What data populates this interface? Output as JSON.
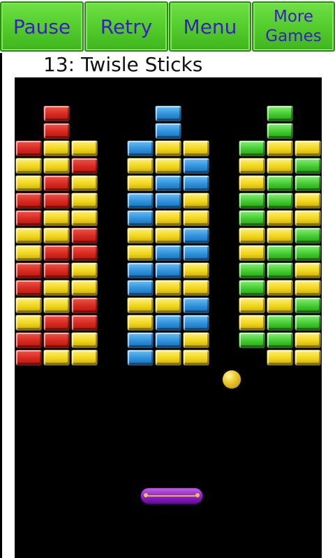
{
  "toolbar": {
    "pause_label": "Pause",
    "retry_label": "Retry",
    "menu_label": "Menu",
    "more_games_label": "More\nGames"
  },
  "level": {
    "title": "13: Twisle Sticks"
  },
  "colors": {
    "button_green": "#56cf2e",
    "button_text": "#3a1fc0",
    "brick_red": "#d62a20",
    "brick_yellow": "#f1d61b",
    "brick_blue": "#2f92dc",
    "brick_green": "#43cc2f",
    "ball": "#f2cf34",
    "paddle": "#8e22c9"
  },
  "bricks": {
    "legend": {
      "R": "red",
      "Y": "yellow",
      "B": "blue",
      "G": "green"
    },
    "groups": [
      {
        "name": "red-stick",
        "rows": [
          "-R-",
          "-R-",
          "RYY",
          "YYR",
          "YRY",
          "RRY",
          "RYY",
          "YYR",
          "YRR",
          "RRY",
          "RYY",
          "YYR",
          "YRR",
          "RRY",
          "RYY"
        ]
      },
      {
        "name": "blue-stick",
        "rows": [
          "-B-",
          "-B-",
          "BYY",
          "YYB",
          "YBB",
          "BBY",
          "BYY",
          "YYB",
          "YBB",
          "BBY",
          "BYY",
          "YYB",
          "YBB",
          "BBY",
          "BYY"
        ]
      },
      {
        "name": "green-stick",
        "rows": [
          "-G-",
          "-G-",
          "GYY",
          "YYG",
          "YGG",
          "GGY",
          "GYY",
          "YYG",
          "YGG",
          "GGY",
          "GYY",
          "YYG",
          "YGG",
          "GG Y",
          "-YY"
        ]
      }
    ]
  }
}
